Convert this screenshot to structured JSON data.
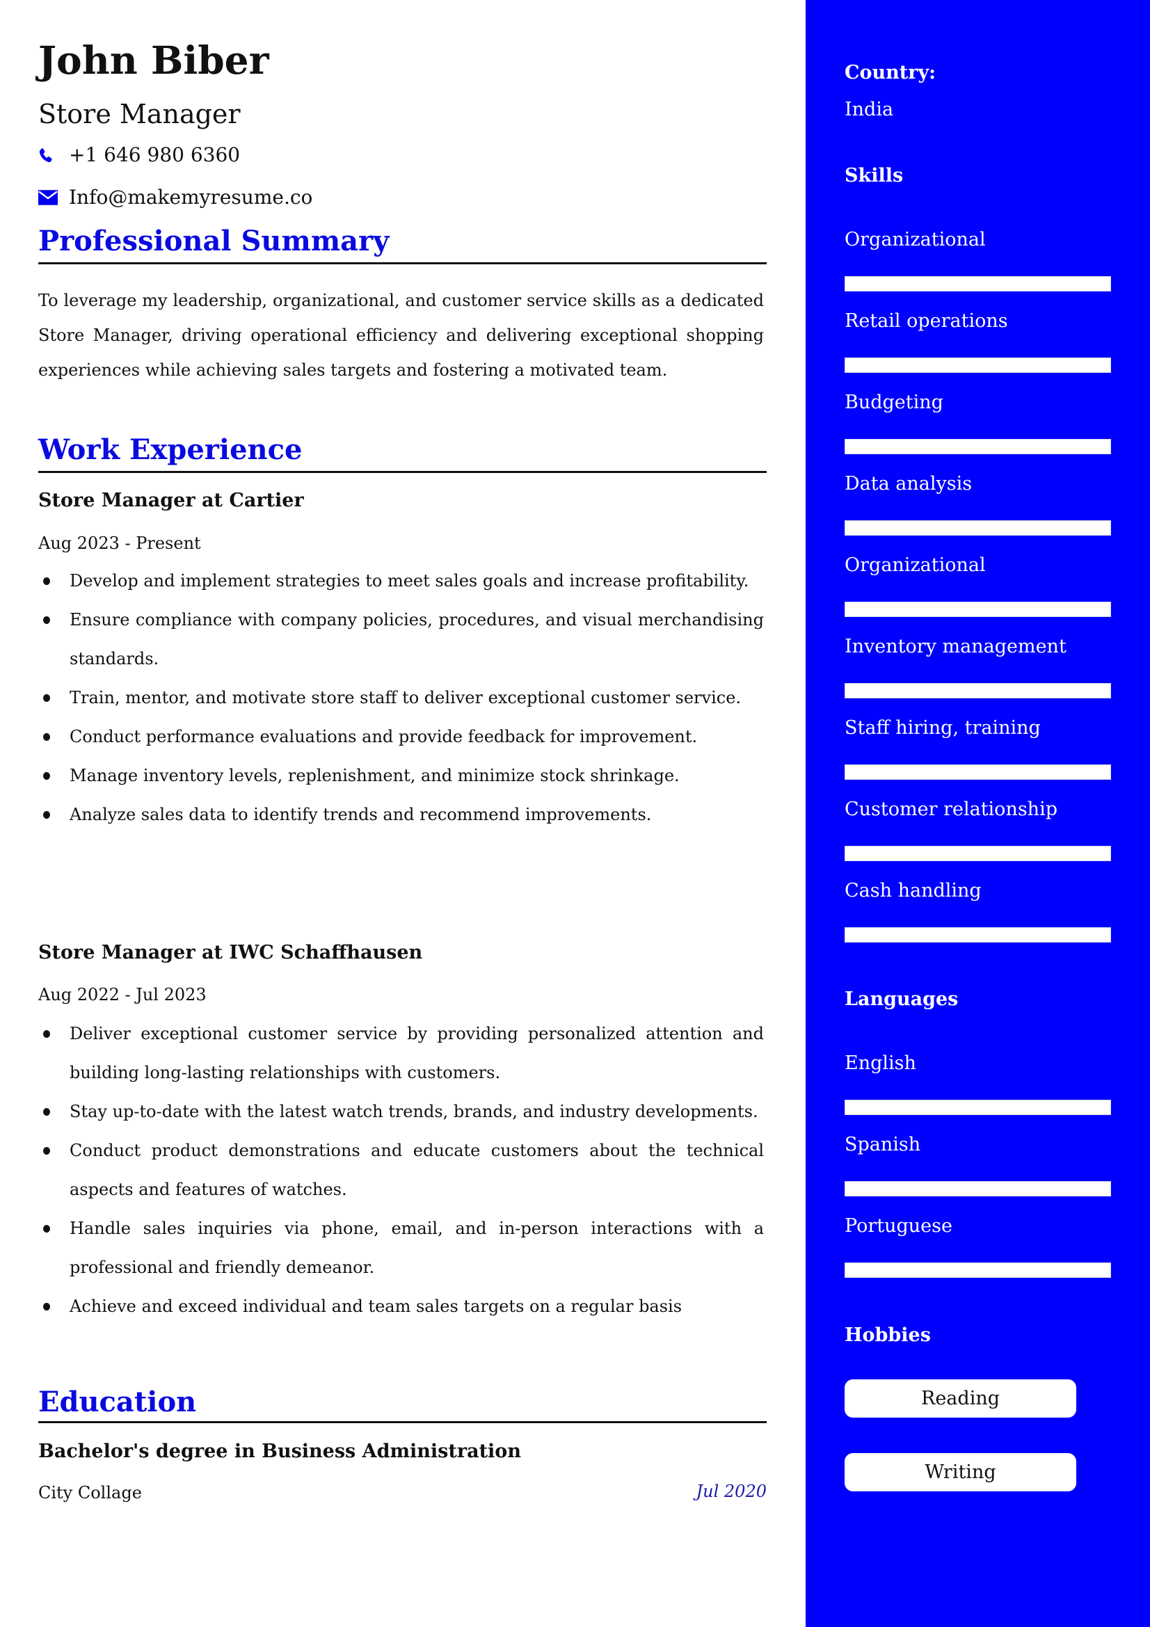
{
  "header": {
    "name": "John Biber",
    "title": "Store Manager",
    "phone": "+1 646 980 6360",
    "email": "Info@makemyresume.co",
    "icons": {
      "phone": "phone-icon",
      "email": "envelope-icon"
    }
  },
  "colors": {
    "sidebar_bg": "#0000ff",
    "section_title": "#0a0ae0",
    "edu_date": "#1a1aa6"
  },
  "summary": {
    "heading": "Professional Summary",
    "text": "To leverage my leadership, organizational, and customer service skills as a dedicated Store Manager, driving operational efficiency and delivering exceptional shopping experiences while achieving sales targets and fostering a motivated team."
  },
  "experience": {
    "heading": "Work Experience",
    "jobs": [
      {
        "title": "Store Manager at Cartier",
        "dates": "Aug 2023 - Present",
        "bullets": [
          "Develop and implement strategies to meet sales goals and increase profitability.",
          "Ensure compliance with company policies, procedures, and visual merchandising standards.",
          "Train, mentor, and motivate store staff to deliver exceptional customer service.",
          "Conduct performance evaluations and provide feedback for improvement.",
          "Manage inventory levels, replenishment, and minimize stock shrinkage.",
          "Analyze sales data to identify trends and recommend improvements."
        ]
      },
      {
        "title": "Store Manager at IWC Schaffhausen",
        "dates": "Aug 2022 - Jul 2023",
        "bullets": [
          "Deliver exceptional customer service by providing personalized attention and building long-lasting relationships with customers.",
          "Stay up-to-date with the latest watch trends, brands, and industry developments.",
          "Conduct product demonstrations and educate customers about the technical aspects and features of watches.",
          "Handle sales inquiries via phone, email, and in-person interactions with a professional and friendly demeanor.",
          "Achieve and exceed individual and team sales targets on a regular basis"
        ]
      }
    ]
  },
  "education": {
    "heading": "Education",
    "degree": "Bachelor's degree in Business Administration",
    "school": "City Collage",
    "date": "Jul 2020"
  },
  "sidebar": {
    "country_label": "Country:",
    "country_value": "India",
    "skills_heading": "Skills",
    "skills": [
      {
        "label": "Organizational",
        "level": 1.0
      },
      {
        "label": "Retail operations",
        "level": 1.0
      },
      {
        "label": "Budgeting",
        "level": 1.0
      },
      {
        "label": "Data analysis",
        "level": 1.0
      },
      {
        "label": "Organizational",
        "level": 1.0
      },
      {
        "label": "Inventory management",
        "level": 1.0
      },
      {
        "label": "Staff hiring, training",
        "level": 1.0
      },
      {
        "label": "Customer relationship",
        "level": 1.0
      },
      {
        "label": "Cash handling",
        "level": 1.0
      }
    ],
    "languages_heading": "Languages",
    "languages": [
      {
        "label": "English",
        "level": 1.0
      },
      {
        "label": "Spanish",
        "level": 1.0
      },
      {
        "label": "Portuguese",
        "level": 1.0
      }
    ],
    "hobbies_heading": "Hobbies",
    "hobbies": [
      "Reading",
      "Writing"
    ]
  }
}
